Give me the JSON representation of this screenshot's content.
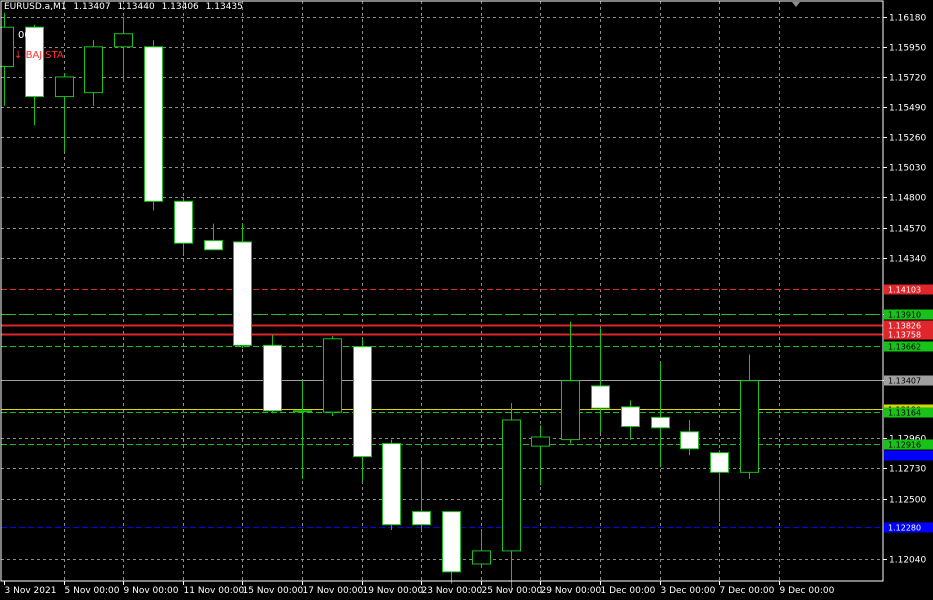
{
  "window": {
    "symbol": "EURUSD.a,M1",
    "ohlc": [
      "1.13407",
      "1.13440",
      "1.13406",
      "1.13435"
    ]
  },
  "overlay": {
    "note": "00",
    "signal_label": "BAJISTA",
    "signal_icon": "arrow-down-icon"
  },
  "colors": {
    "background": "#000000",
    "grid": "#8c8c8c",
    "bull_body": "#000000",
    "bear_body": "#ffffff",
    "candle_outline": "#19c219",
    "axis_text": "#ffffff",
    "red_level": "#e0262a",
    "green_level": "#19a119",
    "yellow_level": "#d7d700",
    "blue_level": "#0000ff",
    "bid_line": "#a0a0a0"
  },
  "price_axis": {
    "ticks": [
      "1.16180",
      "1.15950",
      "1.15720",
      "1.15490",
      "1.15260",
      "1.15030",
      "1.14800",
      "1.14570",
      "1.14340",
      "1.13910",
      "1.13407",
      "1.12960",
      "1.12730",
      "1.12500",
      "1.12040"
    ],
    "range": [
      1.1187,
      1.163
    ]
  },
  "time_axis": {
    "labels": [
      "3 Nov 2021",
      "5 Nov 00:00",
      "9 Nov 00:00",
      "11 Nov 00:00",
      "15 Nov 00:00",
      "17 Nov 00:00",
      "19 Nov 00:00",
      "23 Nov 00:00",
      "25 Nov 00:00",
      "29 Nov 00:00",
      "1 Dec 00:00",
      "3 Dec 00:00",
      "7 Dec 00:00",
      "9 Dec 00:00"
    ]
  },
  "levels": [
    {
      "price": 1.14103,
      "label": "1.14103",
      "color": "#e0262a",
      "style": "dashed",
      "tag": true
    },
    {
      "price": 1.1391,
      "label": "1.13910",
      "color": "#19c219",
      "style": "dashed",
      "tag": true
    },
    {
      "price": 1.13826,
      "label": "1.13826",
      "color": "#e0262a",
      "style": "solid",
      "tag": true
    },
    {
      "price": 1.13758,
      "label": "1.13758",
      "color": "#e0262a",
      "style": "solid",
      "tag": true
    },
    {
      "price": 1.13662,
      "label": "1.13662",
      "color": "#19c219",
      "style": "dashed",
      "tag": true
    },
    {
      "price": 1.13407,
      "label": "1.13407",
      "color": "#a0a0a0",
      "style": "solid",
      "tag": true
    },
    {
      "price": 1.1318,
      "label": "1.13180",
      "color": "#d7d700",
      "style": "solid",
      "tag": true
    },
    {
      "price": 1.13164,
      "label": "1.13164",
      "color": "#19c219",
      "style": "dashed",
      "tag": true
    },
    {
      "price": 1.12916,
      "label": "1.12916",
      "color": "#19c219",
      "style": "dashed",
      "tag": true
    },
    {
      "price": 1.1283,
      "label": "",
      "color": "#0000ff",
      "style": "none",
      "tag": true
    },
    {
      "price": 1.1228,
      "label": "1.12280",
      "color": "#0000ff",
      "style": "dashed",
      "tag": true
    }
  ],
  "chart_data": {
    "type": "candlestick",
    "symbol": "EURUSD.a",
    "candles": [
      {
        "o": 1.158,
        "h": 1.1621,
        "l": 1.155,
        "c": 1.161
      },
      {
        "o": 1.161,
        "h": 1.1612,
        "l": 1.1535,
        "c": 1.1557
      },
      {
        "o": 1.1557,
        "h": 1.1575,
        "l": 1.1515,
        "c": 1.1572
      },
      {
        "o": 1.156,
        "h": 1.16,
        "l": 1.155,
        "c": 1.1595
      },
      {
        "o": 1.1595,
        "h": 1.1618,
        "l": 1.157,
        "c": 1.1605
      },
      {
        "o": 1.1595,
        "h": 1.16,
        "l": 1.147,
        "c": 1.1477
      },
      {
        "o": 1.1477,
        "h": 1.148,
        "l": 1.1437,
        "c": 1.1445
      },
      {
        "o": 1.1447,
        "h": 1.146,
        "l": 1.144,
        "c": 1.144
      },
      {
        "o": 1.1446,
        "h": 1.146,
        "l": 1.1365,
        "c": 1.1367
      },
      {
        "o": 1.1367,
        "h": 1.1375,
        "l": 1.1315,
        "c": 1.1317
      },
      {
        "o": 1.1317,
        "h": 1.134,
        "l": 1.1265,
        "c": 1.1317
      },
      {
        "o": 1.1316,
        "h": 1.1374,
        "l": 1.1313,
        "c": 1.1372
      },
      {
        "o": 1.1366,
        "h": 1.1372,
        "l": 1.1263,
        "c": 1.1282
      },
      {
        "o": 1.1292,
        "h": 1.1295,
        "l": 1.1226,
        "c": 1.123
      },
      {
        "o": 1.124,
        "h": 1.128,
        "l": 1.1225,
        "c": 1.123
      },
      {
        "o": 1.124,
        "h": 1.124,
        "l": 1.1185,
        "c": 1.1194
      },
      {
        "o": 1.12,
        "h": 1.1225,
        "l": 1.1197,
        "c": 1.121
      },
      {
        "o": 1.121,
        "h": 1.1323,
        "l": 1.118,
        "c": 1.131
      },
      {
        "o": 1.129,
        "h": 1.1306,
        "l": 1.126,
        "c": 1.1297
      },
      {
        "o": 1.1295,
        "h": 1.1385,
        "l": 1.1292,
        "c": 1.134
      },
      {
        "o": 1.1336,
        "h": 1.138,
        "l": 1.13,
        "c": 1.1319
      },
      {
        "o": 1.132,
        "h": 1.1325,
        "l": 1.1295,
        "c": 1.1305
      },
      {
        "o": 1.1312,
        "h": 1.1354,
        "l": 1.1274,
        "c": 1.1304
      },
      {
        "o": 1.1301,
        "h": 1.131,
        "l": 1.1283,
        "c": 1.1288
      },
      {
        "o": 1.1285,
        "h": 1.1287,
        "l": 1.1232,
        "c": 1.127
      },
      {
        "o": 1.127,
        "h": 1.136,
        "l": 1.1265,
        "c": 1.134
      }
    ]
  }
}
